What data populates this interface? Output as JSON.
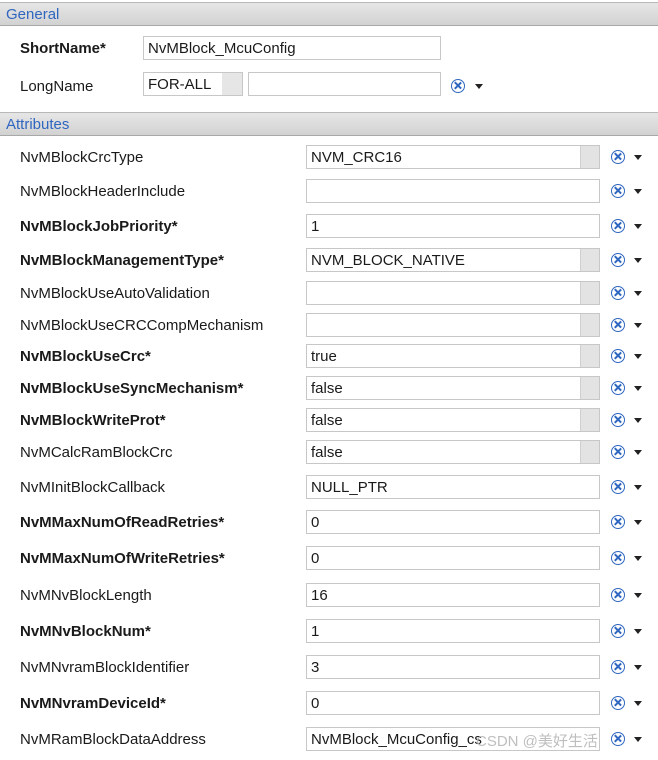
{
  "general": {
    "header": "General",
    "short_name_label": "ShortName*",
    "short_name_value": "NvMBlock_McuConfig",
    "long_name_label": "LongName",
    "long_name_lang": "FOR-ALL",
    "long_name_value": ""
  },
  "attributes": {
    "header": "Attributes",
    "rows": [
      {
        "label": "NvMBlockCrcType",
        "value": "NVM_CRC16",
        "required": false
      },
      {
        "label": "NvMBlockHeaderInclude",
        "value": "",
        "required": false
      },
      {
        "label": "NvMBlockJobPriority*",
        "value": "1",
        "required": true
      },
      {
        "label": "NvMBlockManagementType*",
        "value": "NVM_BLOCK_NATIVE",
        "required": true
      },
      {
        "label": "NvMBlockUseAutoValidation",
        "value": "",
        "required": false
      },
      {
        "label": "NvMBlockUseCRCCompMechanism",
        "value": "",
        "required": false
      },
      {
        "label": "NvMBlockUseCrc*",
        "value": "true",
        "required": true
      },
      {
        "label": "NvMBlockUseSyncMechanism*",
        "value": "false",
        "required": true
      },
      {
        "label": "NvMBlockWriteProt*",
        "value": "false",
        "required": true
      },
      {
        "label": "NvMCalcRamBlockCrc",
        "value": "false",
        "required": false
      },
      {
        "label": "NvMInitBlockCallback",
        "value": "NULL_PTR",
        "required": false
      },
      {
        "label": "NvMMaxNumOfReadRetries*",
        "value": "0",
        "required": true
      },
      {
        "label": "NvMMaxNumOfWriteRetries*",
        "value": "0",
        "required": true
      },
      {
        "label": "NvMNvBlockLength",
        "value": "16",
        "required": false
      },
      {
        "label": "NvMNvBlockNum*",
        "value": "1",
        "required": true
      },
      {
        "label": "NvMNvramBlockIdentifier",
        "value": "3",
        "required": false
      },
      {
        "label": "NvMNvramDeviceId*",
        "value": "0",
        "required": true
      },
      {
        "label": "NvMRamBlockDataAddress",
        "value": "NvMBlock_McuConfig_cs",
        "required": false
      }
    ]
  },
  "icons": {
    "reset": "reset-default-icon",
    "dropdown": "dropdown-arrow-icon"
  },
  "colors": {
    "header_text": "#2f66c0",
    "icon": "#2f66c0"
  },
  "watermark": "CSDN @美好生活"
}
